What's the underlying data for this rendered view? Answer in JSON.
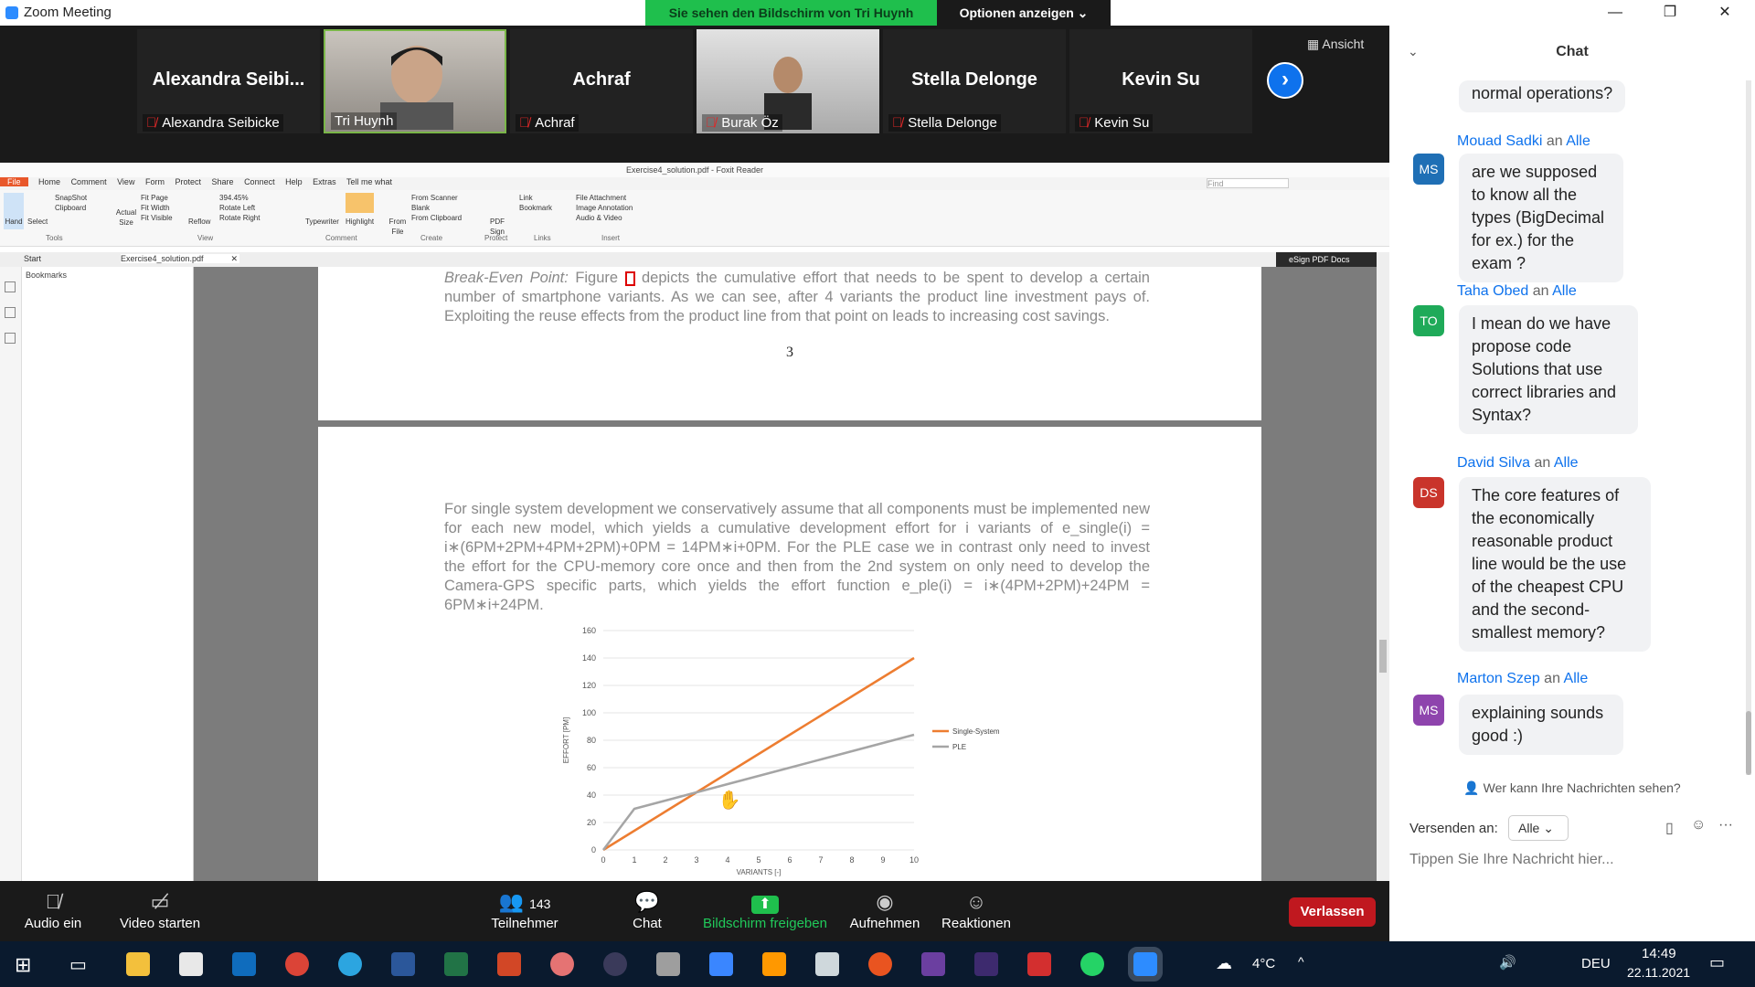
{
  "window": {
    "title": "Zoom Meeting",
    "share_banner": "Sie sehen den Bildschirm von Tri Huynh",
    "options_button": "Optionen anzeigen ⌄"
  },
  "gallery": {
    "view_button": "Ansicht",
    "participants": [
      {
        "big": "Alexandra  Seibi...",
        "name": "Alexandra Seibicke",
        "muted": true,
        "video": false
      },
      {
        "big": "",
        "name": "Tri Huynh",
        "muted": false,
        "video": true
      },
      {
        "big": "Achraf",
        "name": "Achraf",
        "muted": true,
        "video": false
      },
      {
        "big": "",
        "name": "Burak Öz",
        "muted": true,
        "video": true
      },
      {
        "big": "Stella Delonge",
        "name": "Stella Delonge",
        "muted": true,
        "video": false
      },
      {
        "big": "Kevin Su",
        "name": "Kevin Su",
        "muted": true,
        "video": false
      }
    ]
  },
  "foxit": {
    "doc_title": "Exercise4_solution.pdf - Foxit Reader",
    "menu": [
      "File",
      "Home",
      "Comment",
      "View",
      "Form",
      "Protect",
      "Share",
      "Connect",
      "Help",
      "Extras",
      "Tell me what"
    ],
    "find_placeholder": "Find",
    "ribbon": {
      "hand": "Hand",
      "select": "Select",
      "snapshot": "SnapShot",
      "clipboard": "Clipboard",
      "actual_size": "Actual Size",
      "fit_page": "Fit Page",
      "fit_width": "Fit Width",
      "fit_visible": "Fit Visible",
      "reflow": "Reflow",
      "zoom": "394.45%",
      "rotate_left": "Rotate Left",
      "rotate_right": "Rotate Right",
      "typewriter": "Typewriter",
      "highlight": "Highlight",
      "from_file": "From File",
      "from_scanner": "From Scanner",
      "blank": "Blank",
      "from_clipboard": "From Clipboard",
      "pdf_sign": "PDF Sign",
      "link": "Link",
      "bookmark": "Bookmark",
      "file_attachment": "File Attachment",
      "image_annotation": "Image Annotation",
      "audio_video": "Audio & Video",
      "groups": [
        "Tools",
        "View",
        "Comment",
        "Create",
        "Protect",
        "Links",
        "Insert"
      ]
    },
    "tabs": {
      "start": "Start",
      "doc": "Exercise4_solution.pdf"
    },
    "esign": "eSign PDF Docs",
    "bookmarks": "Bookmarks"
  },
  "pdf": {
    "para1_lead": "Break-Even Point:",
    "para1_fig": "Figure",
    "para1_rest": "depicts the cumulative effort that needs to be spent to develop a certain number of smartphone variants.  As we can see, after 4 variants the product line investment pays of. Exploiting the reuse effects from the product line from that point on leads to increasing cost savings.",
    "page_number": "3",
    "para2": "For single system development we conservatively assume that all components must be implemented new for each new model, which yields a cumulative development effort for i variants of e_single(i) = i∗(6PM+2PM+4PM+2PM)+0PM = 14PM∗i+0PM. For the PLE case we in contrast only need to invest the effort for the CPU-memory core once and then from the 2nd system on only need to develop the Camera-GPS specific parts, which yields the effort function e_ple(i) = i∗(4PM+2PM)+24PM = 6PM∗i+24PM."
  },
  "chart_data": {
    "type": "line",
    "x": [
      0,
      1,
      2,
      3,
      4,
      5,
      6,
      7,
      8,
      9,
      10
    ],
    "xlabel": "VARIANTS [-]",
    "ylabel": "EFFORT [PM]",
    "ylim": [
      0,
      160
    ],
    "yticks": [
      0,
      20,
      40,
      60,
      80,
      100,
      120,
      140,
      160
    ],
    "grid": true,
    "legend": "right",
    "series": [
      {
        "name": "Single-System",
        "color": "#ed7d31",
        "values": [
          0,
          14,
          28,
          42,
          56,
          70,
          84,
          98,
          112,
          126,
          140
        ]
      },
      {
        "name": "PLE",
        "color": "#a5a5a5",
        "values": [
          0,
          30,
          36,
          42,
          48,
          54,
          60,
          66,
          72,
          78,
          84
        ]
      }
    ]
  },
  "toolbar": {
    "audio": "Audio ein",
    "video": "Video starten",
    "participants": "Teilnehmer",
    "participants_count": "143",
    "chat": "Chat",
    "share": "Bildschirm freigeben",
    "record": "Aufnehmen",
    "reactions": "Reaktionen",
    "leave": "Verlassen"
  },
  "chat": {
    "title": "Chat",
    "partial_message": "normal operations?",
    "to_word": "an",
    "messages": [
      {
        "sender": "Mouad Sadki",
        "to": "Alle",
        "initials": "MS",
        "color": "#1f6fb5",
        "text": "are we supposed to know all the types (BigDecimal for ex.) for the exam ?"
      },
      {
        "sender": "Taha Obed",
        "to": "Alle",
        "initials": "TO",
        "color": "#1faa59",
        "text": "I mean do we have propose code Solutions that use correct libraries and Syntax?"
      },
      {
        "sender": "David Silva",
        "to": "Alle",
        "initials": "DS",
        "color": "#c9342b",
        "text": "The core features of the economically reasonable product line would be the use of the cheapest CPU and the second-smallest memory?"
      },
      {
        "sender": "Marton Szep",
        "to": "Alle",
        "initials": "MS",
        "color": "#8e44ad",
        "text": "explaining sounds good :)"
      }
    ],
    "who_sees": "Wer kann Ihre Nachrichten sehen?",
    "send_to_label": "Versenden an:",
    "send_to_value": "Alle",
    "input_placeholder": "Tippen Sie Ihre Nachricht hier..."
  },
  "taskbar": {
    "weather": "4°C",
    "lang": "DEU",
    "time": "14:49",
    "date": "22.11.2021"
  }
}
